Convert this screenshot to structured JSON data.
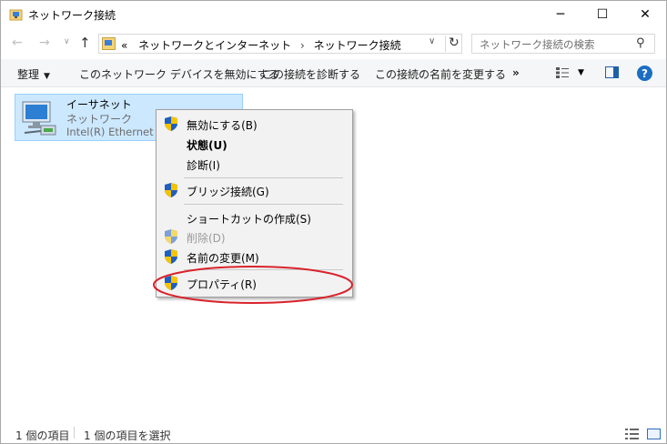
{
  "window": {
    "title": "ネットワーク接続"
  },
  "title_buttons": {
    "minimize": "─",
    "maximize": "☐",
    "close": "✕"
  },
  "nav": {
    "back": "←",
    "forward": "→",
    "history": "∨",
    "up": "↑"
  },
  "address": {
    "overflow": "«",
    "crumb1": "ネットワークとインターネット",
    "separator": "›",
    "crumb2": "ネットワーク接続",
    "dropdown": "∨",
    "refresh": "↻"
  },
  "search": {
    "placeholder": "ネットワーク接続の検索",
    "icon": "⚲"
  },
  "commands": {
    "organize": "整理",
    "organize_caret": "▼",
    "disable": "このネットワーク デバイスを無効にする",
    "diagnose": "この接続を診断する",
    "rename": "この接続の名前を変更する",
    "more": "»",
    "view_caret": "▼",
    "help": "?"
  },
  "connection": {
    "name": "イーサネット",
    "status": "ネットワーク",
    "device": "Intel(R) Ethernet C"
  },
  "context_menu": {
    "disable": "無効にする(B)",
    "status": "状態(U)",
    "diagnose": "診断(I)",
    "bridge": "ブリッジ接続(G)",
    "shortcut": "ショートカットの作成(S)",
    "delete": "削除(D)",
    "rename": "名前の変更(M)",
    "properties": "プロパティ(R)"
  },
  "status_bar": {
    "count": "1 個の項目",
    "selected": "1 個の項目を選択"
  },
  "colors": {
    "selection_bg": "#cce8ff",
    "selection_border": "#99d1ff",
    "annotation_red": "#d9232b",
    "accent_blue": "#1b6ec2"
  }
}
